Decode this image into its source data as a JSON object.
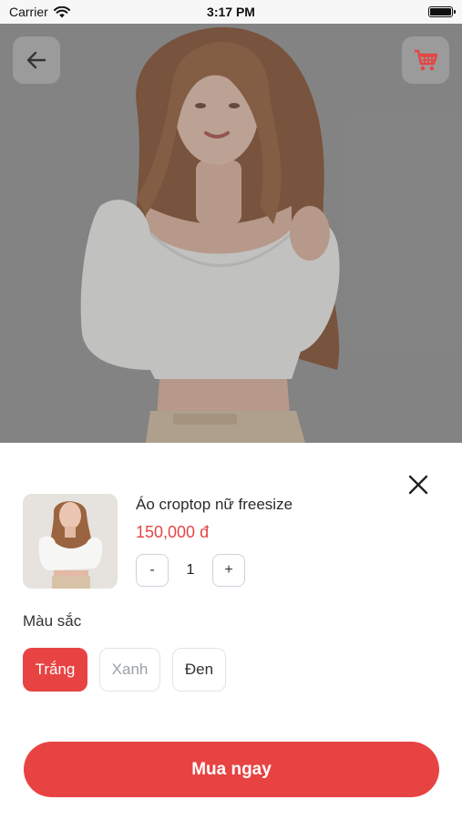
{
  "status_bar": {
    "carrier": "Carrier",
    "time": "3:17 PM"
  },
  "hero": {
    "back_icon": "arrow-left-icon",
    "cart_icon": "shopping-cart-icon",
    "cart_color": "#e84343"
  },
  "product": {
    "name": "Áo croptop nữ freesize",
    "price": "150,000 đ",
    "quantity": {
      "decrement": "-",
      "value": "1",
      "increment": "+"
    }
  },
  "color": {
    "label": "Màu sắc",
    "options": [
      {
        "label": "Trắng",
        "selected": true
      },
      {
        "label": "Xanh",
        "selected": false
      },
      {
        "label": "Đen",
        "selected": false
      }
    ]
  },
  "actions": {
    "buy_label": "Mua ngay"
  },
  "colors": {
    "accent": "#e84343"
  }
}
